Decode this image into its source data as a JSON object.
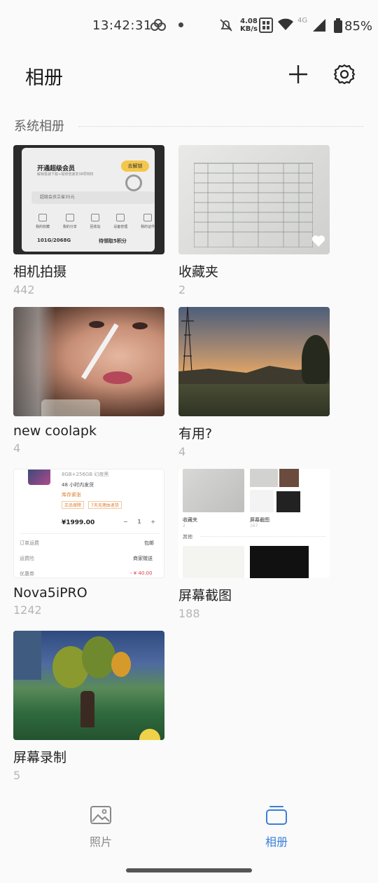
{
  "status_bar": {
    "time": "13:42:31",
    "net_speed_value": "4.08",
    "net_speed_unit": "KB/s",
    "network_type": "4G",
    "battery": "85%"
  },
  "header": {
    "title": "相册",
    "add_icon": "plus-icon",
    "settings_icon": "gear-icon"
  },
  "section": {
    "title": "系统相册"
  },
  "albums": [
    {
      "name": "相机拍摄",
      "count": "442"
    },
    {
      "name": "收藏夹",
      "count": "2"
    },
    {
      "name": "new coolapk",
      "count": "4"
    },
    {
      "name": "有用?",
      "count": "4"
    },
    {
      "name": "Nova5iPRO",
      "count": "1242"
    },
    {
      "name": "屏幕截图",
      "count": "188"
    },
    {
      "name": "屏幕录制",
      "count": "5"
    }
  ],
  "thumb_camera": {
    "vip_title": "开通超级会员",
    "vip_sub": "解锁极速下载+视频倍速享38项特权",
    "unlock": "去解锁",
    "promo": "超级会员立省35元",
    "icons": [
      "我的收藏",
      "我的分享",
      "回收站",
      "设备管理",
      "我的证件"
    ],
    "storage": "101G/2068G",
    "points": "待领取5积分"
  },
  "thumb_shop": {
    "spec": "8GB+256GB 幻夜黑",
    "ship": "48 小时内发货",
    "stock": "库存紧张",
    "tag1": "正品保障",
    "tag2": "7天无理由退货",
    "price": "¥1999.00",
    "qty": "1",
    "row1_label": "订单运费",
    "row1_value": "包邮",
    "row2_label": "运费险",
    "row2_value": "商家赠送",
    "row3_label": "优惠券",
    "row3_value": "- ¥ 40.00"
  },
  "thumb_screens": {
    "label1": "收藏夹",
    "count1": "2",
    "label2": "屏幕截图",
    "count2": "167",
    "other": "其他"
  },
  "bottom_nav": {
    "photos_label": "照片",
    "albums_label": "相册",
    "active_color": "#3b7fd6",
    "inactive_color": "#888888"
  }
}
